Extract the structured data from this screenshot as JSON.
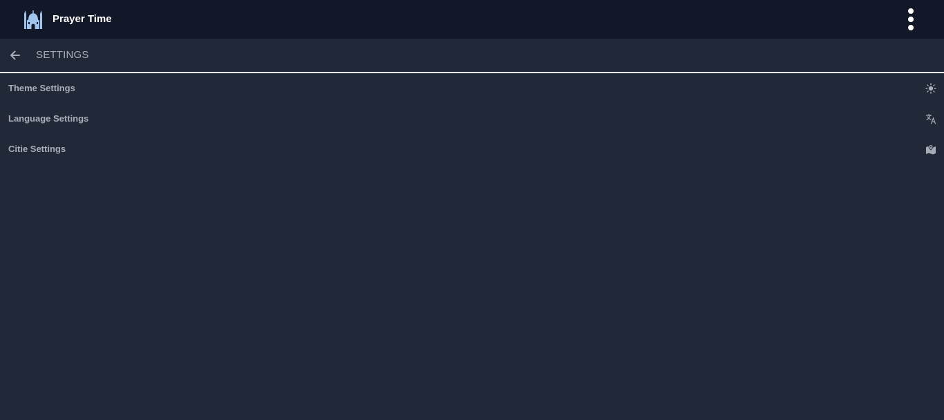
{
  "header": {
    "app_title": "Prayer Time",
    "logo_icon": "mosque-icon",
    "menu_icon": "more-vertical-icon"
  },
  "subheader": {
    "back_icon": "arrow-left-icon",
    "title": "SETTINGS"
  },
  "settings": {
    "items": [
      {
        "label": "Theme Settings",
        "icon": "sun-icon"
      },
      {
        "label": "Language Settings",
        "icon": "translate-icon"
      },
      {
        "label": "Citie Settings",
        "icon": "map-pin-icon"
      }
    ]
  },
  "colors": {
    "topbar_bg": "#121827",
    "page_bg": "#212838",
    "text_muted": "#a8adb8",
    "logo_blue": "#9ec4ee"
  }
}
